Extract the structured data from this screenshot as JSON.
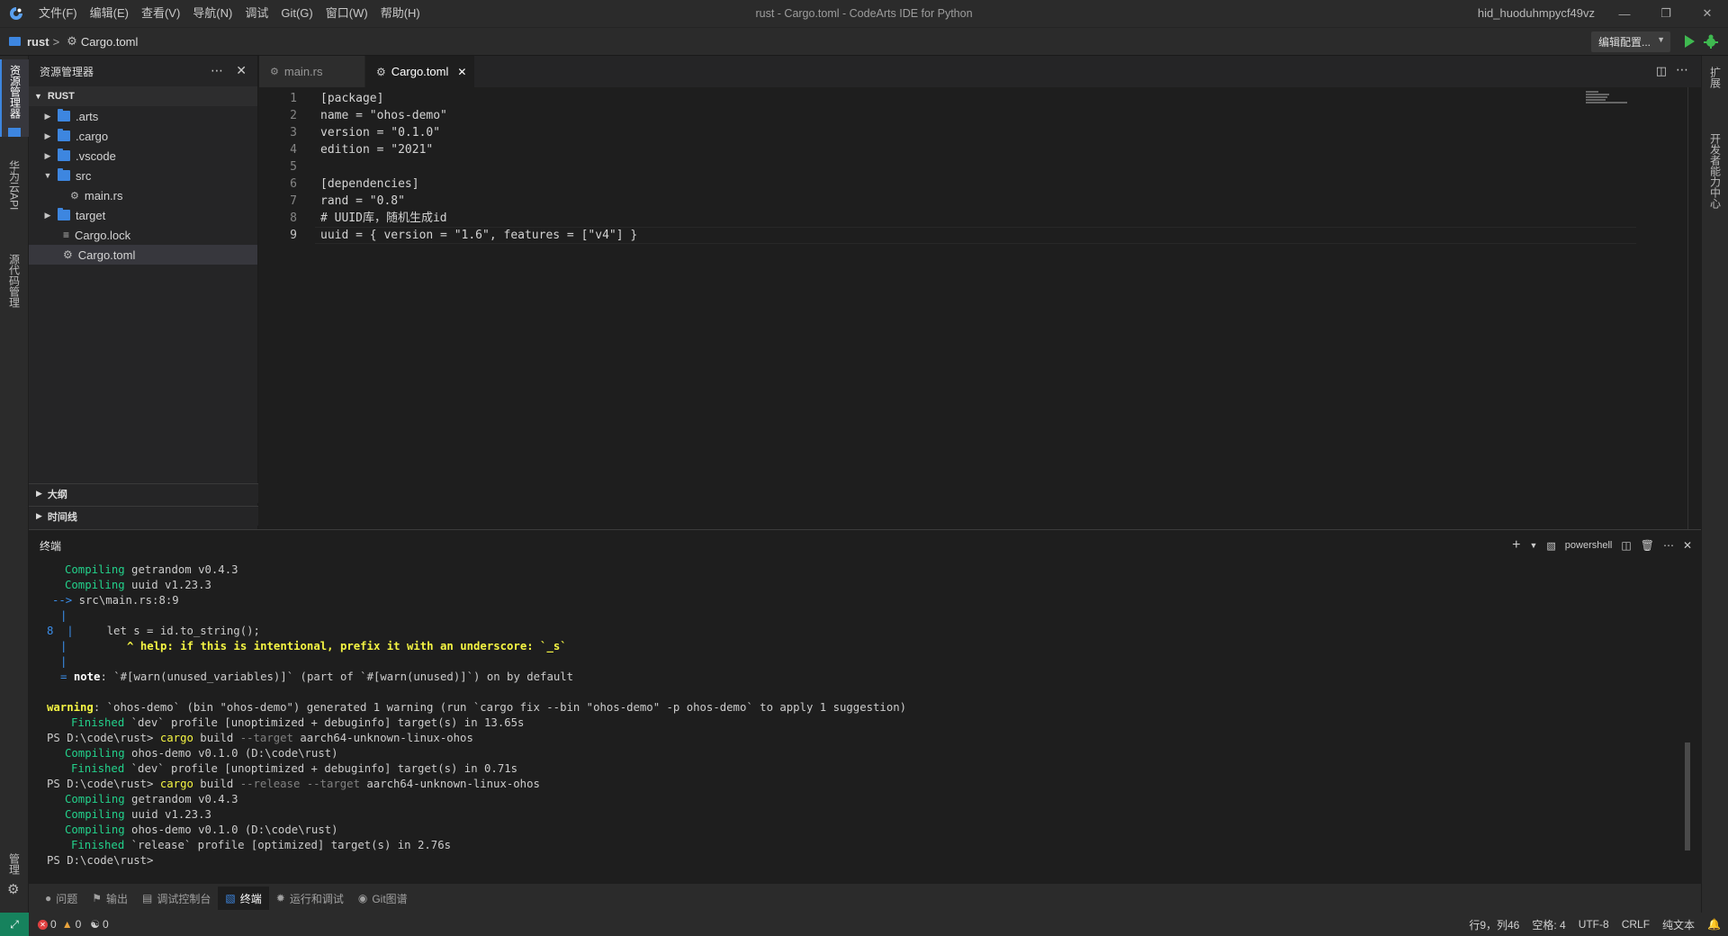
{
  "titlebar": {
    "menu": [
      "文件(F)",
      "编辑(E)",
      "查看(V)",
      "导航(N)",
      "调试",
      "Git(G)",
      "窗口(W)",
      "帮助(H)"
    ],
    "window_title": "rust - Cargo.toml - CodeArts IDE for Python",
    "user": "hid_huoduhmpycf49vz"
  },
  "breadcrumb": {
    "project": "rust",
    "sep": ">",
    "file": "Cargo.toml"
  },
  "run_config": {
    "label": "编辑配置..."
  },
  "activity": {
    "explorer": "资源管理器",
    "huawei_api": "华为云API",
    "source_control": "源代码管理",
    "manage": "管理"
  },
  "rightbar": {
    "extensions": "扩展",
    "dev_center": "开发者能力中心"
  },
  "sidebar": {
    "title": "资源管理器",
    "root": "RUST",
    "items": [
      {
        "label": ".arts",
        "type": "folder",
        "expanded": false
      },
      {
        "label": ".cargo",
        "type": "folder",
        "expanded": false
      },
      {
        "label": ".vscode",
        "type": "folder",
        "expanded": false
      },
      {
        "label": "src",
        "type": "folder",
        "expanded": true
      },
      {
        "label": "main.rs",
        "type": "file"
      },
      {
        "label": "target",
        "type": "folder",
        "expanded": false
      },
      {
        "label": "Cargo.lock",
        "type": "file"
      },
      {
        "label": "Cargo.toml",
        "type": "file",
        "selected": true
      }
    ],
    "outline": "大纲",
    "timeline": "时间线"
  },
  "editor": {
    "tabs": [
      {
        "label": "main.rs",
        "active": false
      },
      {
        "label": "Cargo.toml",
        "active": true
      }
    ],
    "lines": [
      {
        "n": "1",
        "text": "[package]"
      },
      {
        "n": "2",
        "text": "name = \"ohos-demo\""
      },
      {
        "n": "3",
        "text": "version = \"0.1.0\""
      },
      {
        "n": "4",
        "text": "edition = \"2021\""
      },
      {
        "n": "5",
        "text": ""
      },
      {
        "n": "6",
        "text": "[dependencies]"
      },
      {
        "n": "7",
        "text": "rand = \"0.8\""
      },
      {
        "n": "8",
        "text": "# UUID库，随机生成id"
      },
      {
        "n": "9",
        "text": "uuid = { version = \"1.6\", features = [\"v4\"] }"
      }
    ]
  },
  "panel": {
    "title": "终端",
    "shell": "powershell",
    "terminal": {
      "l1": {
        "kw": "Compiling",
        "rest": " getrandom v0.4.3"
      },
      "l2": {
        "kw": "Compiling",
        "rest": " uuid v1.23.3"
      },
      "l3": {
        "kw": "-->",
        "rest": " src\\main.rs:8:9"
      },
      "l4": {
        "kw": "|"
      },
      "l5": {
        "num": "8",
        "bar": "|",
        "rest": "     let s = id.to_string();"
      },
      "l6": {
        "bar": "|",
        "rest": "         ^ help: if this is intentional, prefix it with an underscore: `_s`"
      },
      "l7": {
        "bar": "|"
      },
      "l8": {
        "eq": "=",
        "note": "note",
        "rest": ": `#[warn(unused_variables)]` (part of `#[warn(unused)]`) on by default"
      },
      "l9": {
        "kw": "warning",
        "rest": ": `ohos-demo` (bin \"ohos-demo\") generated 1 warning (run `cargo fix --bin \"ohos-demo\" -p ohos-demo` to apply 1 suggestion)"
      },
      "l10": {
        "kw": "Finished",
        "rest": " `dev` profile [unoptimized + debuginfo] target(s) in 13.65s"
      },
      "l11": {
        "prompt": "PS D:\\code\\rust> ",
        "cmd": "cargo",
        "a1": " build ",
        "flag": "--target",
        "a2": " aarch64-unknown-linux-ohos"
      },
      "l12": {
        "kw": "Compiling",
        "rest": " ohos-demo v0.1.0 (D:\\code\\rust)"
      },
      "l13": {
        "kw": "Finished",
        "rest": " `dev` profile [unoptimized + debuginfo] target(s) in 0.71s"
      },
      "l14": {
        "prompt": "PS D:\\code\\rust> ",
        "cmd": "cargo",
        "a1": " build ",
        "flag": "--release --target",
        "a2": " aarch64-unknown-linux-ohos"
      },
      "l15": {
        "kw": "Compiling",
        "rest": " getrandom v0.4.3"
      },
      "l16": {
        "kw": "Compiling",
        "rest": " uuid v1.23.3"
      },
      "l17": {
        "kw": "Compiling",
        "rest": " ohos-demo v0.1.0 (D:\\code\\rust)"
      },
      "l18": {
        "kw": "Finished",
        "rest": " `release` profile [optimized] target(s) in 2.76s"
      },
      "l19": {
        "prompt": "PS D:\\code\\rust>"
      }
    }
  },
  "tooltabs": [
    "问题",
    "输出",
    "调试控制台",
    "终端",
    "运行和调试",
    "Git图谱"
  ],
  "statusbar": {
    "errors": "0",
    "warnings": "0",
    "ports": "0",
    "position": "行9，列46",
    "spaces": "空格: 4",
    "encoding": "UTF-8",
    "eol": "CRLF",
    "language": "纯文本"
  },
  "colors": {
    "accent_green": "#23d18b",
    "accent_blue": "#3b8eea",
    "warning_yellow": "#f5f543",
    "remote_green": "#16825d"
  }
}
